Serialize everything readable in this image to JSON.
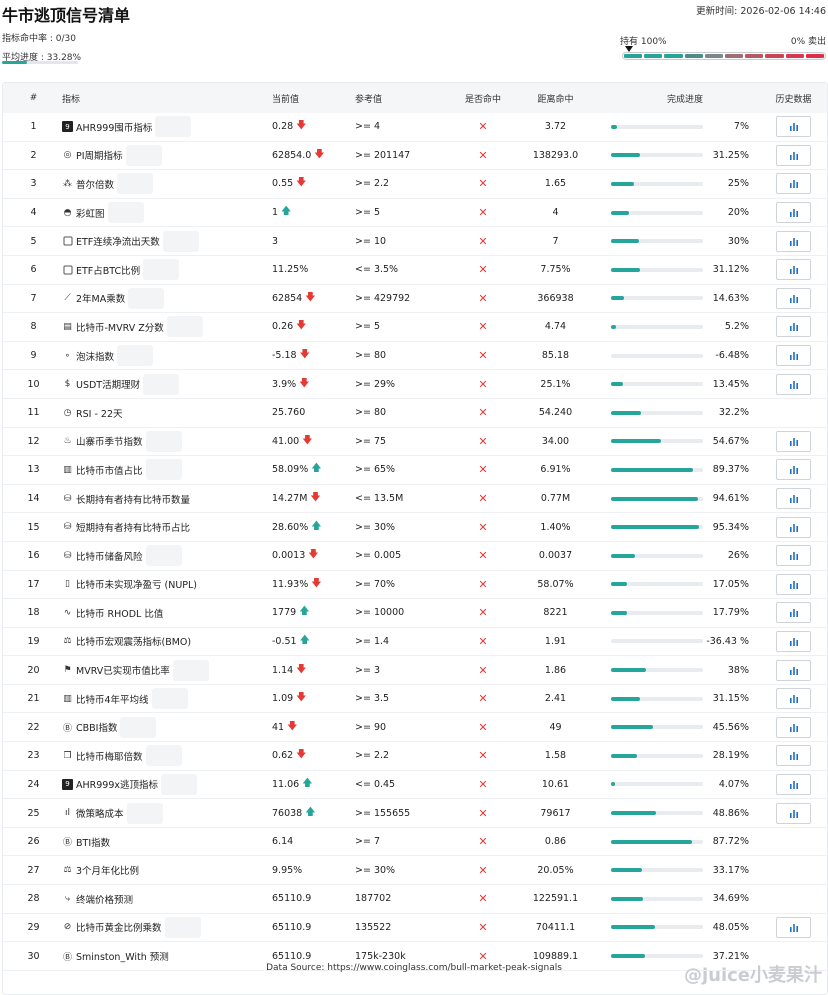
{
  "page": {
    "title": "牛市逃顶信号清单",
    "updated": "更新时间: 2026-02-06 14:46",
    "hit_rate": "指标命中率 : 0/30",
    "avg_progress_label": "平均进度 : 33.28%",
    "avg_progress": 0.3328
  },
  "gauge": {
    "left": "持有 100%",
    "right": "0% 卖出",
    "colors": [
      "#26a69a",
      "#26a69a",
      "#26a69a",
      "#4b8d86",
      "#7a8a8a",
      "#9e6e74",
      "#b85865",
      "#cc4458",
      "#db3650",
      "#e22d4a"
    ]
  },
  "headers": {
    "no": "#",
    "name": "指标",
    "current": "当前值",
    "ref": "参考值",
    "hit": "是否命中",
    "dist": "距离命中",
    "progress": "完成进度",
    "hist": "历史数据"
  },
  "colors": {
    "accent": "#26a69a",
    "down": "#e53935",
    "up": "#26a69a",
    "hist_icon": "#1e6fc7"
  },
  "rows": [
    {
      "no": "1",
      "icon": "9",
      "iconbox": true,
      "name": "AHR999囤币指标",
      "cur": "0.28",
      "dir": "down",
      "ref": ">= 4",
      "dist": "3.72",
      "pct": 7,
      "pct_label": "7%",
      "hist": true,
      "shade": true
    },
    {
      "no": "2",
      "icon": "◎",
      "name": "PI周期指标",
      "cur": "62854.0",
      "dir": "down",
      "ref": ">= 201147",
      "dist": "138293.0",
      "pct": 31.25,
      "pct_label": "31.25%",
      "hist": true,
      "shade": true
    },
    {
      "no": "3",
      "icon": "⁂",
      "name": "普尔倍数",
      "cur": "0.55",
      "dir": "down",
      "ref": ">= 2.2",
      "dist": "1.65",
      "pct": 25,
      "pct_label": "25%",
      "hist": true,
      "shade": true
    },
    {
      "no": "4",
      "icon": "◓",
      "name": "彩虹图",
      "cur": "1",
      "dir": "up",
      "ref": ">= 5",
      "dist": "4",
      "pct": 20,
      "pct_label": "20%",
      "hist": true,
      "shade": true
    },
    {
      "no": "5",
      "icon": "",
      "name": "ETF连续净流出天数",
      "cur": "3",
      "dir": "",
      "ref": ">= 10",
      "dist": "7",
      "pct": 30,
      "pct_label": "30%",
      "hist": true,
      "shade": true
    },
    {
      "no": "6",
      "icon": "",
      "name": "ETF占BTC比例",
      "cur": "11.25%",
      "dir": "",
      "ref": "<= 3.5%",
      "dist": "7.75%",
      "pct": 31.12,
      "pct_label": "31.12%",
      "hist": true,
      "shade": true
    },
    {
      "no": "7",
      "icon": "⟋",
      "name": "2年MA乘数",
      "cur": "62854",
      "dir": "down",
      "ref": ">= 429792",
      "dist": "366938",
      "pct": 14.63,
      "pct_label": "14.63%",
      "hist": true,
      "shade": true
    },
    {
      "no": "8",
      "icon": "▤",
      "name": "比特币-MVRV Z分数",
      "cur": "0.26",
      "dir": "down",
      "ref": ">= 5",
      "dist": "4.74",
      "pct": 5.2,
      "pct_label": "5.2%",
      "hist": true,
      "shade": true
    },
    {
      "no": "9",
      "icon": "∘",
      "name": "泡沫指数",
      "cur": "-5.18",
      "dir": "down",
      "ref": ">= 80",
      "dist": "85.18",
      "pct": 0,
      "pct_label": "-6.48%",
      "hist": true,
      "shade": true
    },
    {
      "no": "10",
      "icon": "$",
      "name": "USDT活期理财",
      "cur": "3.9%",
      "dir": "down",
      "ref": ">= 29%",
      "dist": "25.1%",
      "pct": 13.45,
      "pct_label": "13.45%",
      "hist": true,
      "shade": true
    },
    {
      "no": "11",
      "icon": "◷",
      "name": "RSI - 22天",
      "cur": "25.760",
      "dir": "",
      "ref": ">= 80",
      "dist": "54.240",
      "pct": 32.2,
      "pct_label": "32.2%",
      "hist": false,
      "shade": false
    },
    {
      "no": "12",
      "icon": "♨",
      "name": "山寨币季节指数",
      "cur": "41.00",
      "dir": "down",
      "ref": ">= 75",
      "dist": "34.00",
      "pct": 54.67,
      "pct_label": "54.67%",
      "hist": true,
      "shade": true
    },
    {
      "no": "13",
      "icon": "▥",
      "name": "比特币市值占比",
      "cur": "58.09%",
      "dir": "up",
      "ref": ">= 65%",
      "dist": "6.91%",
      "pct": 89.37,
      "pct_label": "89.37%",
      "hist": true,
      "shade": true
    },
    {
      "no": "14",
      "icon": "⛁",
      "name": "长期持有者持有比特币数量",
      "cur": "14.27M",
      "dir": "down",
      "ref": "<= 13.5M",
      "dist": "0.77M",
      "pct": 94.61,
      "pct_label": "94.61%",
      "hist": true,
      "shade": false
    },
    {
      "no": "15",
      "icon": "⛁",
      "name": "短期持有者持有比特币占比",
      "cur": "28.60%",
      "dir": "up",
      "ref": ">= 30%",
      "dist": "1.40%",
      "pct": 95.34,
      "pct_label": "95.34%",
      "hist": true,
      "shade": false
    },
    {
      "no": "16",
      "icon": "⛁",
      "name": "比特币储备风险",
      "cur": "0.0013",
      "dir": "down",
      "ref": ">= 0.005",
      "dist": "0.0037",
      "pct": 26,
      "pct_label": "26%",
      "hist": true,
      "shade": true
    },
    {
      "no": "17",
      "icon": "▯",
      "name": "比特币未实现净盈亏 (NUPL)",
      "cur": "11.93%",
      "dir": "down",
      "ref": ">= 70%",
      "dist": "58.07%",
      "pct": 17.05,
      "pct_label": "17.05%",
      "hist": true,
      "shade": false
    },
    {
      "no": "18",
      "icon": "∿",
      "name": "比特币 RHODL 比值",
      "cur": "1779",
      "dir": "up",
      "ref": ">= 10000",
      "dist": "8221",
      "pct": 17.79,
      "pct_label": "17.79%",
      "hist": true,
      "shade": false
    },
    {
      "no": "19",
      "icon": "⚖",
      "name": "比特币宏观震荡指标(BMO)",
      "cur": "-0.51",
      "dir": "up",
      "ref": ">= 1.4",
      "dist": "1.91",
      "pct": 0,
      "pct_label": "-36.43 %",
      "hist": true,
      "shade": false
    },
    {
      "no": "20",
      "icon": "⚑",
      "name": "MVRV已实现市值比率",
      "cur": "1.14",
      "dir": "down",
      "ref": ">= 3",
      "dist": "1.86",
      "pct": 38,
      "pct_label": "38%",
      "hist": true,
      "shade": true
    },
    {
      "no": "21",
      "icon": "▥",
      "name": "比特币4年平均线",
      "cur": "1.09",
      "dir": "down",
      "ref": ">= 3.5",
      "dist": "2.41",
      "pct": 31.15,
      "pct_label": "31.15%",
      "hist": true,
      "shade": true
    },
    {
      "no": "22",
      "icon": "Ⓑ",
      "name": "CBBI指数",
      "cur": "41",
      "dir": "down",
      "ref": ">= 90",
      "dist": "49",
      "pct": 45.56,
      "pct_label": "45.56%",
      "hist": true,
      "shade": true
    },
    {
      "no": "23",
      "icon": "❐",
      "name": "比特币梅耶倍数",
      "cur": "0.62",
      "dir": "down",
      "ref": ">= 2.2",
      "dist": "1.58",
      "pct": 28.19,
      "pct_label": "28.19%",
      "hist": true,
      "shade": true
    },
    {
      "no": "24",
      "icon": "9",
      "iconbox": true,
      "name": "AHR999x逃顶指标",
      "cur": "11.06",
      "dir": "up",
      "ref": "<= 0.45",
      "dist": "10.61",
      "pct": 4.07,
      "pct_label": "4.07%",
      "hist": true,
      "shade": true
    },
    {
      "no": "25",
      "icon": "ıl",
      "name": "微策略成本",
      "cur": "76038",
      "dir": "up",
      "ref": ">= 155655",
      "dist": "79617",
      "pct": 48.86,
      "pct_label": "48.86%",
      "hist": true,
      "shade": true
    },
    {
      "no": "26",
      "icon": "Ⓑ",
      "name": "BTI指数",
      "cur": "6.14",
      "dir": "",
      "ref": ">= 7",
      "dist": "0.86",
      "pct": 87.72,
      "pct_label": "87.72%",
      "hist": false,
      "shade": false
    },
    {
      "no": "27",
      "icon": "⚖",
      "name": "3个月年化比例",
      "cur": "9.95%",
      "dir": "",
      "ref": ">= 30%",
      "dist": "20.05%",
      "pct": 33.17,
      "pct_label": "33.17%",
      "hist": false,
      "shade": false
    },
    {
      "no": "28",
      "icon": "⤷",
      "name": "终端价格预测",
      "cur": "65110.9",
      "dir": "",
      "ref": "187702",
      "dist": "122591.1",
      "pct": 34.69,
      "pct_label": "34.69%",
      "hist": false,
      "shade": false
    },
    {
      "no": "29",
      "icon": "⊘",
      "name": "比特币黄金比例乘数",
      "cur": "65110.9",
      "dir": "",
      "ref": "135522",
      "dist": "70411.1",
      "pct": 48.05,
      "pct_label": "48.05%",
      "hist": true,
      "shade": true
    },
    {
      "no": "30",
      "icon": "Ⓑ",
      "name": "Sminston_With 预测",
      "cur": "65110.9",
      "dir": "",
      "ref": "175k-230k",
      "dist": "109889.1",
      "pct": 37.21,
      "pct_label": "37.21%",
      "hist": false,
      "shade": false
    }
  ],
  "footer": "Data Source: https://www.coinglass.com/bull-market-peak-signals",
  "watermark": "@juice小麦果汁"
}
